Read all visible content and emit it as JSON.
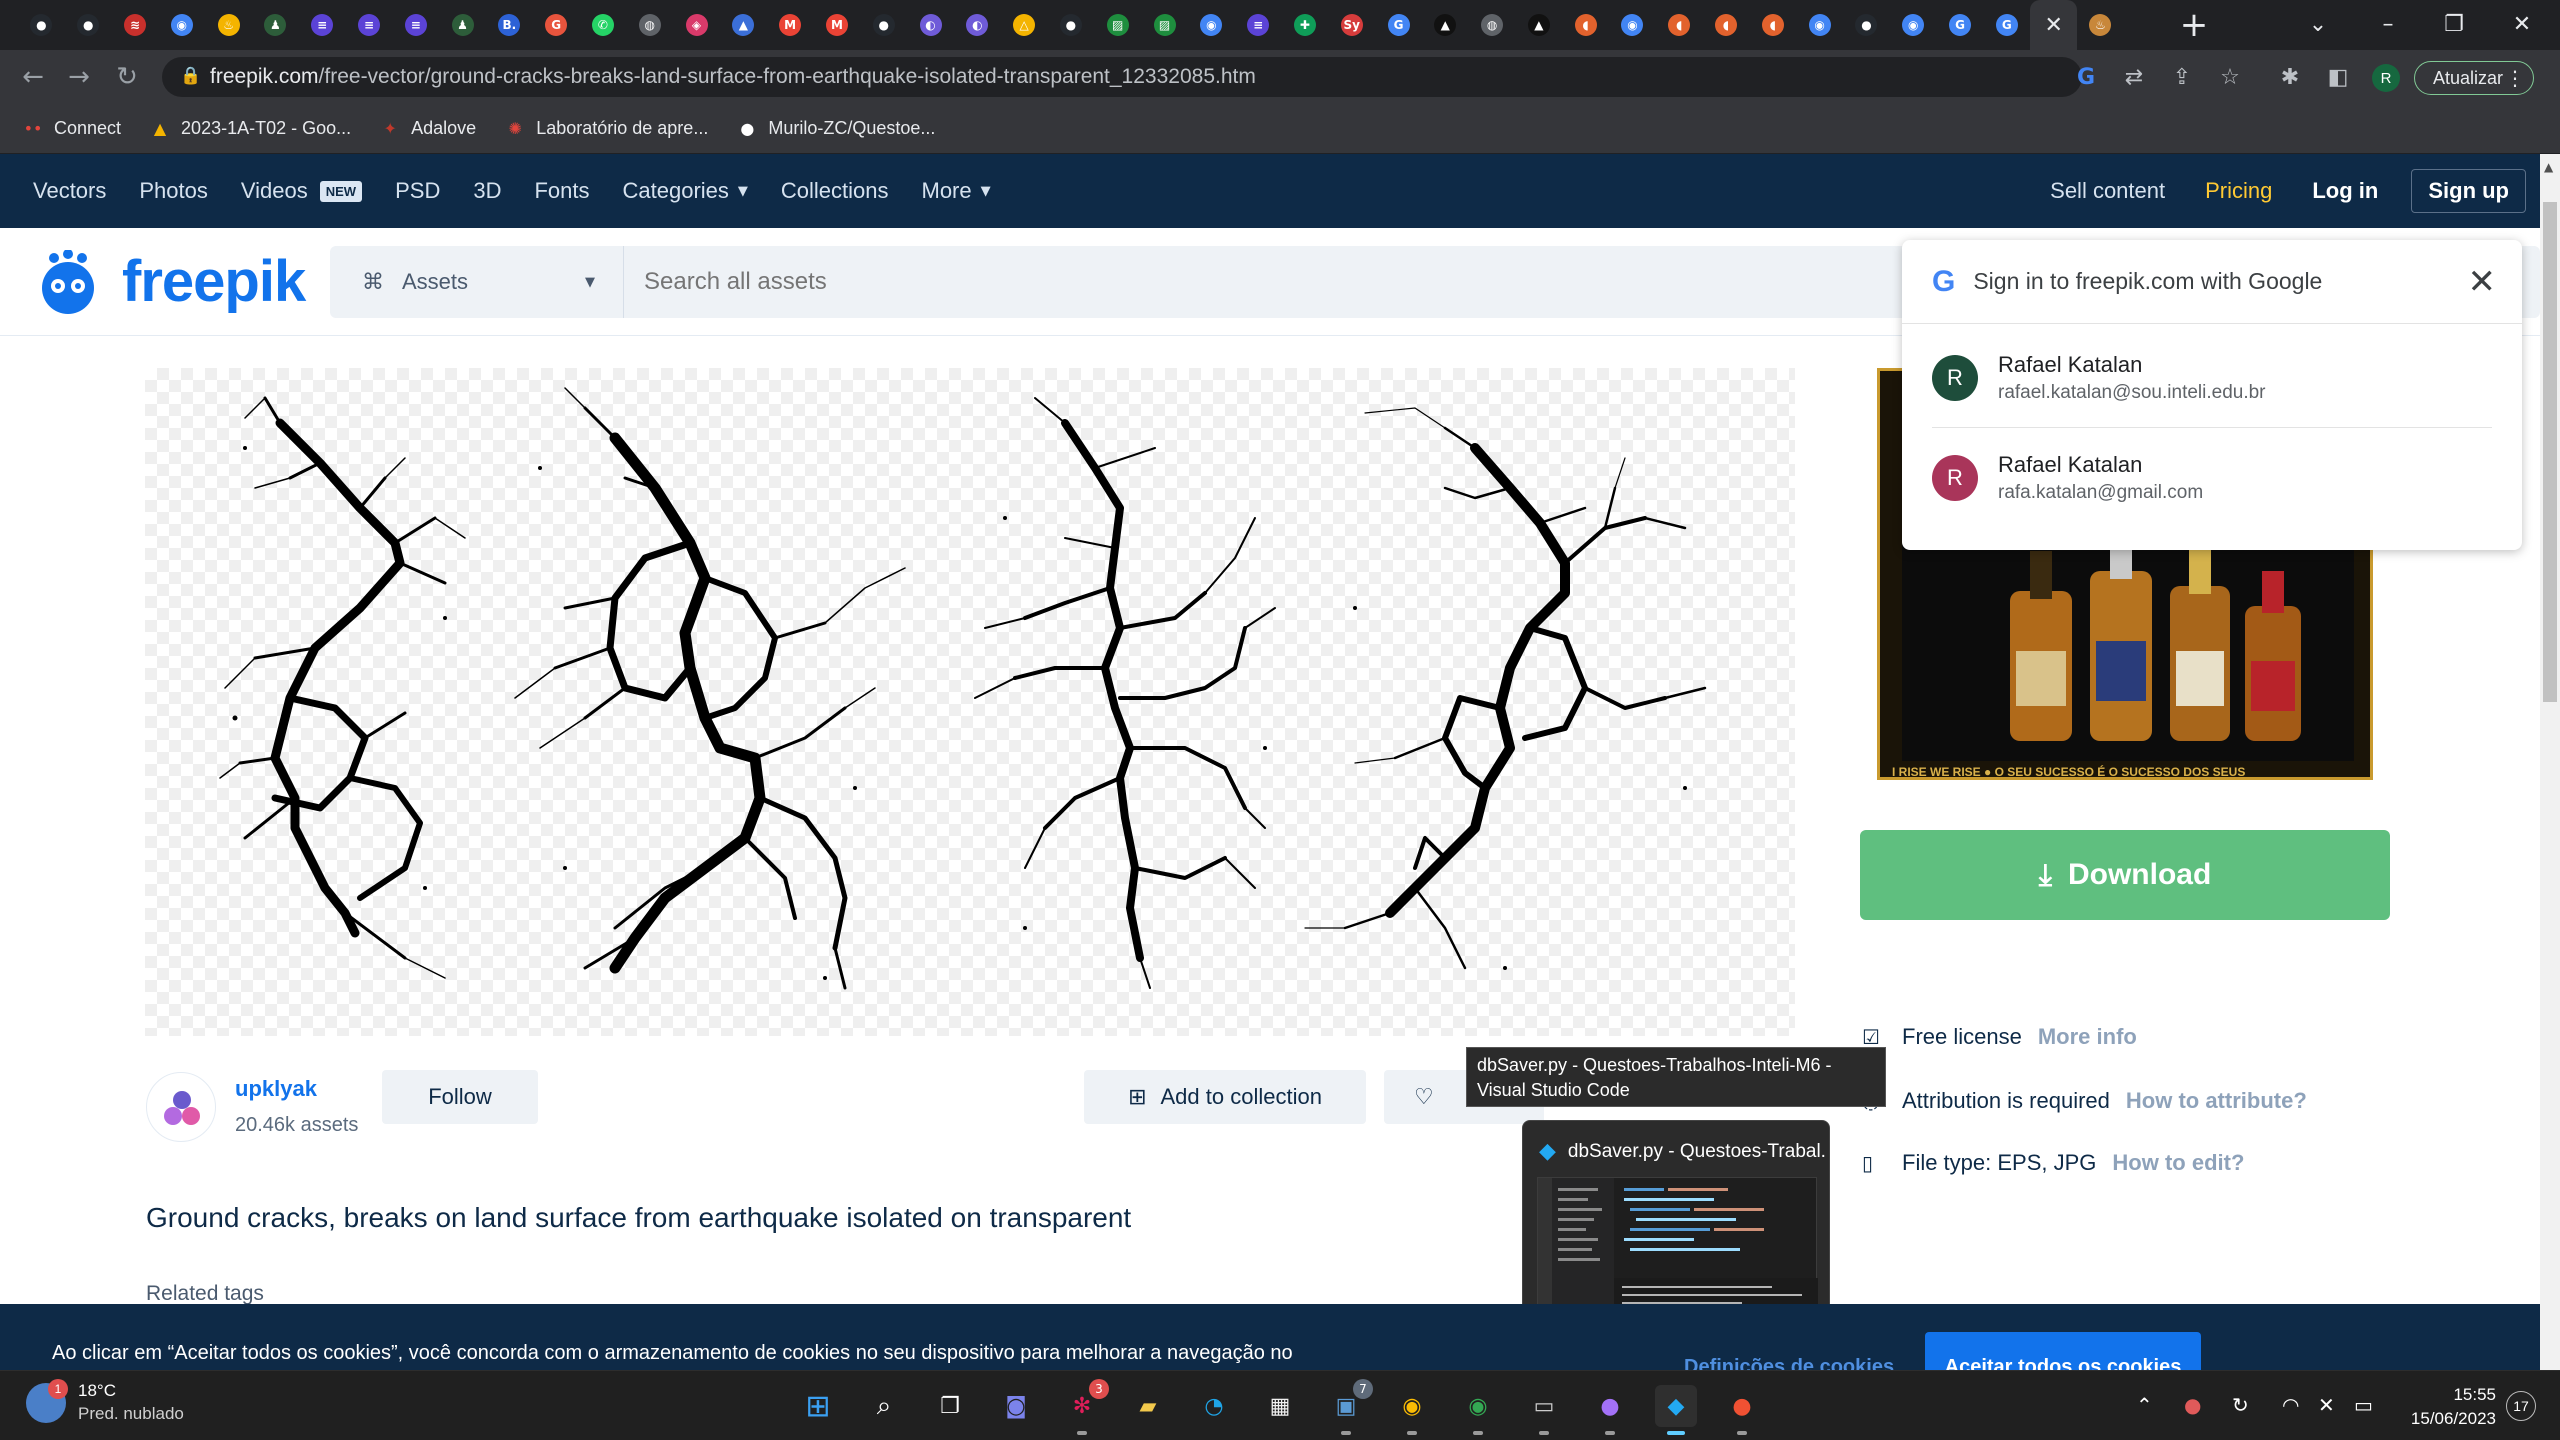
{
  "browser": {
    "tabs": [
      {
        "icon": "github-icon",
        "color": "#24292f"
      },
      {
        "icon": "github-icon",
        "color": "#24292f"
      },
      {
        "icon": "red-logo-icon",
        "color": "#c8302c"
      },
      {
        "icon": "chrome-icon",
        "color": "#4285f4"
      },
      {
        "icon": "flame-icon",
        "color": "#f4b400"
      },
      {
        "icon": "pin-icon",
        "color": "#2d5d3a"
      },
      {
        "icon": "list-icon",
        "color": "#5b43d6"
      },
      {
        "icon": "list-icon",
        "color": "#5b43d6"
      },
      {
        "icon": "list-icon",
        "color": "#5b43d6"
      },
      {
        "icon": "pin-icon",
        "color": "#2d5d3a"
      },
      {
        "icon": "b-icon",
        "color": "#2d62d6"
      },
      {
        "icon": "g-icon",
        "color": "#e8543d"
      },
      {
        "icon": "whatsapp-icon",
        "color": "#25d366"
      },
      {
        "icon": "globe-icon",
        "color": "#5f6368"
      },
      {
        "icon": "marker-icon",
        "color": "#d93a6a"
      },
      {
        "icon": "triangle-icon",
        "color": "#3b6fd8"
      },
      {
        "icon": "gmail-icon",
        "color": "#ea4335"
      },
      {
        "icon": "gmail-icon",
        "color": "#ea4335"
      },
      {
        "icon": "github-icon",
        "color": "#24292f"
      },
      {
        "icon": "moon-icon",
        "color": "#6f5bd8"
      },
      {
        "icon": "moon-icon",
        "color": "#6f5bd8"
      },
      {
        "icon": "drive-icon",
        "color": "#f4b400"
      },
      {
        "icon": "github-icon",
        "color": "#24292f"
      },
      {
        "icon": "chart-icon",
        "color": "#1e8e3e"
      },
      {
        "icon": "chart-icon",
        "color": "#1e8e3e"
      },
      {
        "icon": "chrome-icon",
        "color": "#4285f4"
      },
      {
        "icon": "list-icon",
        "color": "#5b43d6"
      },
      {
        "icon": "sheets-icon",
        "color": "#0f9d58"
      },
      {
        "icon": "sy-icon",
        "color": "#d63c3c"
      },
      {
        "icon": "google-icon",
        "color": "#4285f4"
      },
      {
        "icon": "a-icon",
        "color": "#111111"
      },
      {
        "icon": "globe-icon",
        "color": "#5f6368"
      },
      {
        "icon": "a-icon",
        "color": "#111111"
      },
      {
        "icon": "figma-icon",
        "color": "#e2622d"
      },
      {
        "icon": "chrome-icon",
        "color": "#4285f4"
      },
      {
        "icon": "figma-icon",
        "color": "#e2622d"
      },
      {
        "icon": "figma-icon",
        "color": "#e2622d"
      },
      {
        "icon": "figma-icon",
        "color": "#e2622d"
      },
      {
        "icon": "chrome-icon",
        "color": "#4285f4"
      },
      {
        "icon": "github-icon",
        "color": "#24292f"
      },
      {
        "icon": "chrome-icon",
        "color": "#4285f4"
      },
      {
        "icon": "google-icon",
        "color": "#4285f4"
      },
      {
        "icon": "google-icon",
        "color": "#4285f4"
      }
    ],
    "url_domain": "freepik.com",
    "url_path": "/free-vector/ground-cracks-breaks-land-surface-from-earthquake-isolated-transparent_12332085.htm",
    "profile_initial": "R",
    "update_label": "Atualizar",
    "bookmarks": [
      {
        "icon": "connect-icon",
        "label": "Connect"
      },
      {
        "icon": "drive-icon",
        "label": "2023-1A-T02 - Goo..."
      },
      {
        "icon": "adalove-icon",
        "label": "Adalove"
      },
      {
        "icon": "lab-icon",
        "label": "Laboratório de apre..."
      },
      {
        "icon": "github-icon",
        "label": "Murilo-ZC/Questoe..."
      }
    ]
  },
  "nav": {
    "items": [
      "Vectors",
      "Photos",
      "Videos",
      "PSD",
      "3D",
      "Fonts",
      "Categories",
      "Collections",
      "More"
    ],
    "new_badge": "NEW",
    "sell": "Sell content",
    "pricing": "Pricing",
    "login": "Log in",
    "signup": "Sign up"
  },
  "logo": "freepik",
  "search": {
    "category": "Assets",
    "placeholder": "Search all assets"
  },
  "asset": {
    "author": "upklyak",
    "author_assets": "20.46k assets",
    "follow": "Follow",
    "add_collection": "Add to collection",
    "title": "Ground cracks, breaks on land surface from earthquake isolated on transparent",
    "related_tags": "Related tags"
  },
  "sidebar": {
    "download": "Download",
    "license": "Free license",
    "license_more": "More info",
    "attribution": "Attribution is required",
    "attribution_more": "How to attribute?",
    "filetype": "File type: EPS, JPG",
    "filetype_more": "How to edit?",
    "ad_text": "I RISE WE RISE ● O SEU SUCESSO É O SUCESSO DOS SEUS"
  },
  "google": {
    "title": "Sign in to freepik.com with Google",
    "accounts": [
      {
        "initial": "R",
        "name": "Rafael Katalan",
        "email": "rafael.katalan@sou.inteli.edu.br",
        "color": "#1e4d3b"
      },
      {
        "initial": "R",
        "name": "Rafael Katalan",
        "email": "rafa.katalan@gmail.com",
        "color": "#a9355a"
      }
    ]
  },
  "tooltip": "dbSaver.py - Questoes-Trabalhos-Inteli-M6 - Visual Studio Code",
  "thumbnail_title": "dbSaver.py - Questoes-Trabal...",
  "cookie": {
    "text": "Ao clicar em “Aceitar todos os cookies”, você concorda com o armazenamento de cookies no seu dispositivo para melhorar a navegação no",
    "settings": "Definições de cookies",
    "accept": "Aceitar todos os cookies"
  },
  "taskbar": {
    "weather_temp": "18°C",
    "weather_desc": "Pred. nublado",
    "weather_badge": "1",
    "slack_badge": "3",
    "teams_badge": "7",
    "time": "15:55",
    "date": "15/06/2023",
    "notifications": "17"
  }
}
